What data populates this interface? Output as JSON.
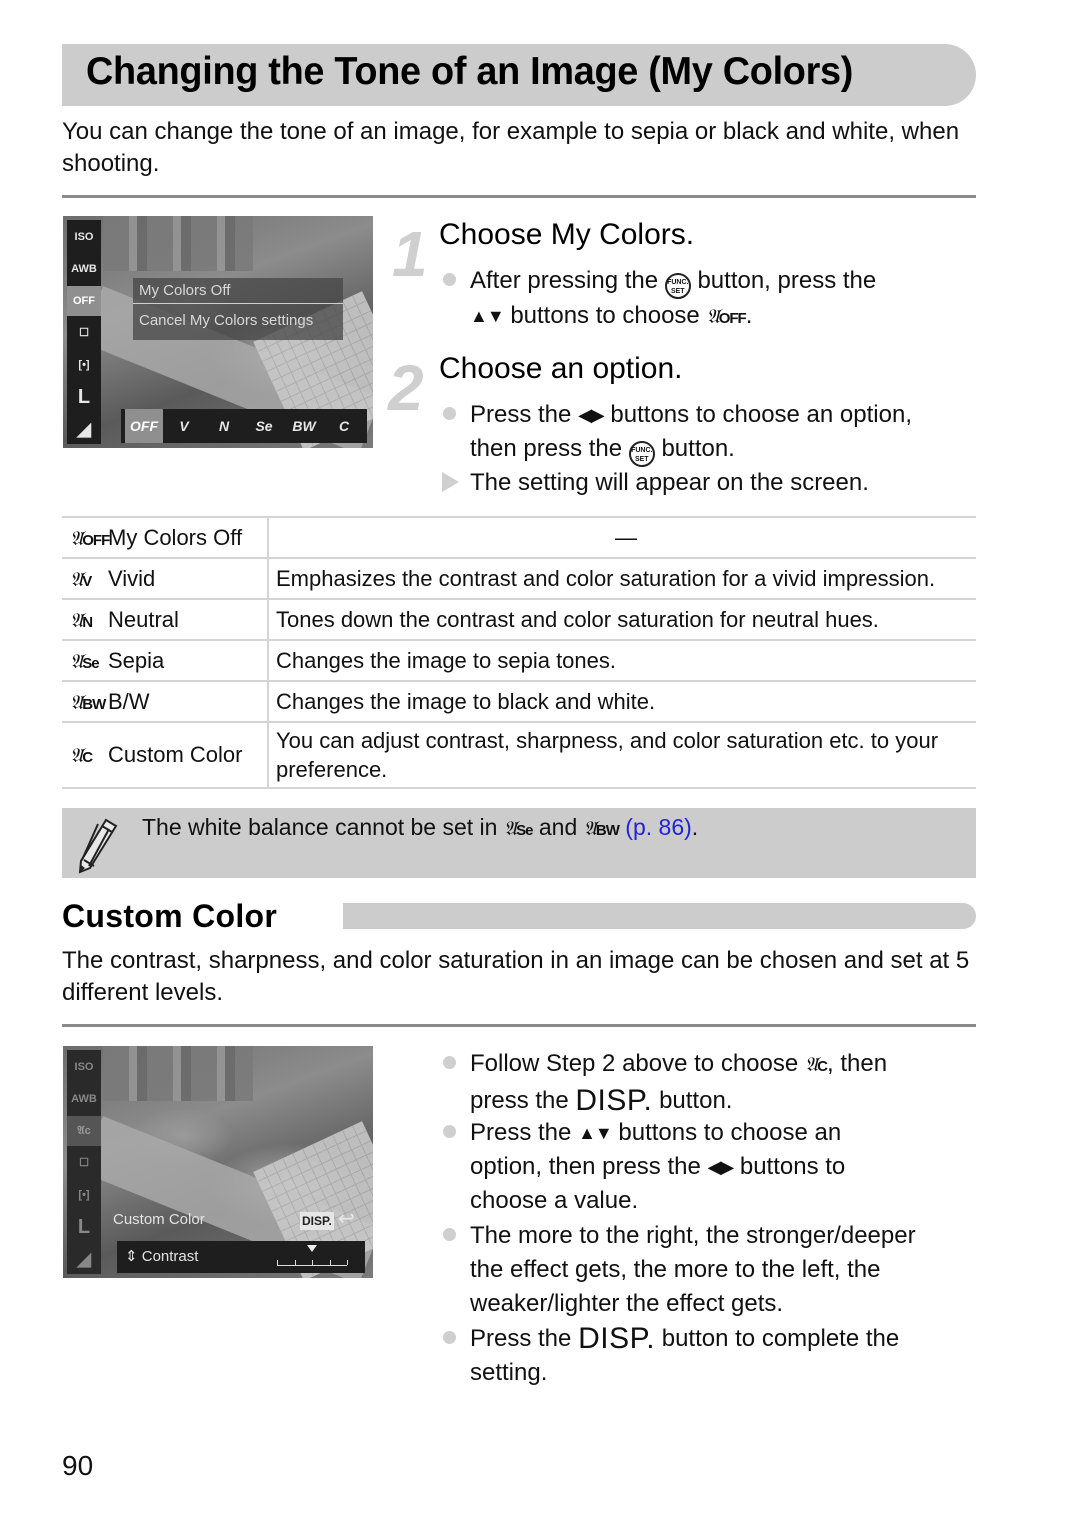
{
  "page": {
    "title": "Changing the Tone of an Image (My Colors)",
    "intro": "You can change the tone of an image, for example to sepia or black and white, when shooting.",
    "page_number": "90"
  },
  "camera_screen_1": {
    "left_icons": [
      "ISO AUTO",
      "AWB",
      "My Colors Off",
      "Drive",
      "Metering",
      "L",
      "Compression"
    ],
    "selected_left_icon": "My Colors Off",
    "menu_title": "My Colors Off",
    "menu_description": "Cancel My Colors settings",
    "options": [
      "OFF",
      "V",
      "N",
      "Se",
      "BW",
      "C"
    ],
    "selected_option": "OFF"
  },
  "steps": [
    {
      "number": "1",
      "title": "Choose My Colors.",
      "bullets": [
        {
          "type": "dot",
          "parts": [
            "After pressing the",
            "button, press the",
            "buttons to choose",
            "."
          ],
          "func_top": "FUNC.",
          "func_bottom": "SET",
          "updown": "▲▼",
          "icon": "OFF"
        }
      ]
    },
    {
      "number": "2",
      "title": "Choose an option.",
      "bullets": [
        {
          "type": "dot",
          "parts": [
            "Press the",
            "buttons to choose an option,",
            "then press the",
            "button."
          ],
          "leftright": "◀▶",
          "func_top": "FUNC.",
          "func_bottom": "SET"
        },
        {
          "type": "result",
          "text": "The setting will appear on the screen."
        }
      ]
    }
  ],
  "options_table": [
    {
      "icon": "OFF",
      "name": "My Colors Off",
      "description": "—"
    },
    {
      "icon": "V",
      "name": "Vivid",
      "description": "Emphasizes the contrast and color saturation for a vivid impression."
    },
    {
      "icon": "N",
      "name": "Neutral",
      "description": "Tones down the contrast and color saturation for neutral hues."
    },
    {
      "icon": "Se",
      "name": "Sepia",
      "description": "Changes the image to sepia tones."
    },
    {
      "icon": "BW",
      "name": "B/W",
      "description": "Changes the image to black and white."
    },
    {
      "icon": "C",
      "name": "Custom Color",
      "description": "You can adjust contrast, sharpness, and color saturation etc. to your preference."
    }
  ],
  "note": {
    "text_before": "The white balance cannot be set in",
    "icon1": "Se",
    "text_middle": "and",
    "icon2": "BW",
    "link": "(p. 86)",
    "text_after": ".",
    "link_color": "#2222dd"
  },
  "custom_color": {
    "heading": "Custom Color",
    "intro": "The contrast, sharpness, and color saturation in an image can be chosen and set at 5 different levels.",
    "camera_screen": {
      "caption": "Custom Color",
      "disp_label": "DISP.",
      "setting_label": "Contrast",
      "levels": 5,
      "current_level": 3
    },
    "bullets": [
      {
        "parts": [
          "Follow Step 2 above to choose",
          ", then",
          "press the",
          "button."
        ],
        "icon": "C",
        "disp": "DISP."
      },
      {
        "parts": [
          "Press the",
          "buttons to choose an",
          "option, then press the",
          "buttons to",
          "choose a value."
        ],
        "updown": "▲▼",
        "leftright": "◀▶"
      },
      {
        "lines": [
          "The more to the right, the stronger/deeper",
          "the effect gets, the more to the left, the",
          "weaker/lighter the effect gets."
        ]
      },
      {
        "parts": [
          "Press the",
          "button to complete the",
          "setting."
        ],
        "disp": "DISP."
      }
    ]
  },
  "colors": {
    "banner_gray": "#cccccc",
    "rule_gray": "#8a8a8a",
    "step_number_gray": "#cfcfcf"
  }
}
